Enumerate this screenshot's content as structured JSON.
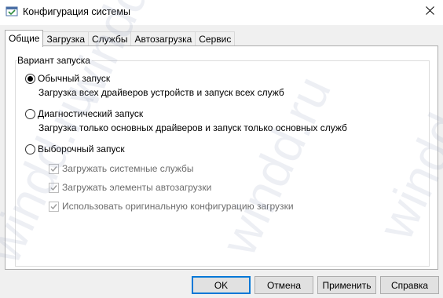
{
  "window": {
    "title": "Конфигурация системы",
    "icon": "msconfig-icon",
    "close_glyph": "✕"
  },
  "tabs": [
    {
      "label": "Общие",
      "active": true
    },
    {
      "label": "Загрузка",
      "active": false
    },
    {
      "label": "Службы",
      "active": false
    },
    {
      "label": "Автозагрузка",
      "active": false
    },
    {
      "label": "Сервис",
      "active": false
    }
  ],
  "startup_group": {
    "title": "Вариант запуска",
    "options": [
      {
        "label": "Обычный запуск",
        "description": "Загрузка всех драйверов устройств и запуск всех служб",
        "checked": true
      },
      {
        "label": "Диагностический запуск",
        "description": "Загрузка только основных драйверов и запуск только основных служб",
        "checked": false
      },
      {
        "label": "Выборочный запуск",
        "checked": false
      }
    ],
    "selective_items": [
      {
        "label": "Загружать системные службы",
        "checked": true,
        "enabled": false
      },
      {
        "label": "Загружать элементы автозагрузки",
        "checked": true,
        "enabled": false
      },
      {
        "label": "Использовать оригинальную конфигурацию загрузки",
        "checked": true,
        "enabled": false
      }
    ]
  },
  "buttons": {
    "ok": "OK",
    "cancel": "Отмена",
    "apply": "Применить",
    "help": "Справка"
  },
  "watermark": {
    "text": "windd.ru",
    "color": "#9aa7c4"
  }
}
